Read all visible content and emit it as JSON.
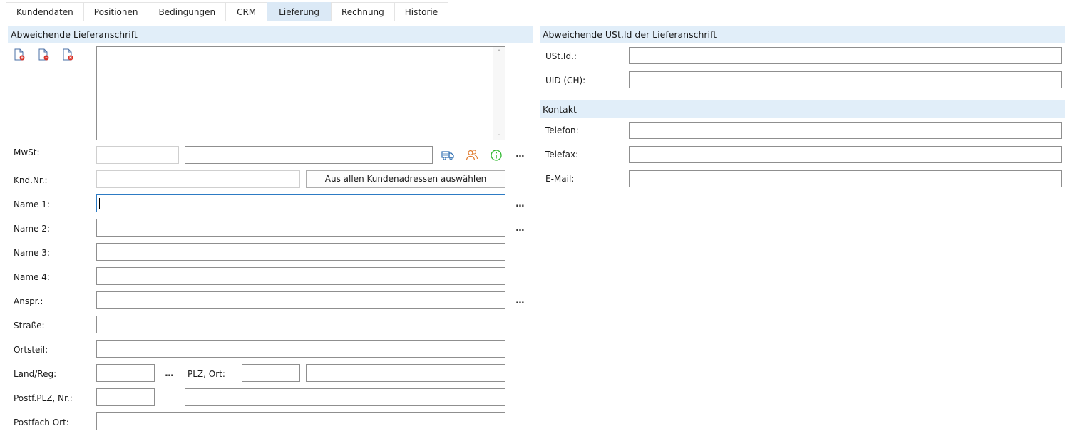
{
  "tabs": [
    {
      "label": "Kundendaten"
    },
    {
      "label": "Positionen"
    },
    {
      "label": "Bedingungen"
    },
    {
      "label": "CRM"
    },
    {
      "label": "Lieferung"
    },
    {
      "label": "Rechnung"
    },
    {
      "label": "Historie"
    }
  ],
  "active_tab": "Lieferung",
  "left": {
    "header": "Abweichende Lieferanschrift",
    "icons": [
      "document-add-icon",
      "document-copy-icon",
      "document-delete-icon"
    ],
    "address_text": "",
    "mwst_label": "MwSt:",
    "mwst_code": "",
    "mwst_text": "",
    "kndnr_label": "Knd.Nr.:",
    "kndnr_value": "",
    "select_button": "Aus allen Kundenadressen auswählen",
    "name1_label": "Name 1:",
    "name1_value": "",
    "name2_label": "Name 2:",
    "name2_value": "",
    "name3_label": "Name 3:",
    "name3_value": "",
    "name4_label": "Name 4:",
    "name4_value": "",
    "anspr_label": "Anspr.:",
    "anspr_value": "",
    "strasse_label": "Straße:",
    "strasse_value": "",
    "ortsteil_label": "Ortsteil:",
    "ortsteil_value": "",
    "land_label": "Land/Reg:",
    "land_value": "",
    "plzort_label": "PLZ, Ort:",
    "plz_value": "",
    "ort_value": "",
    "postfplz_label": "Postf.PLZ, Nr.:",
    "postfplz_value": "",
    "postfnr_value": "",
    "postfort_label": "Postfach Ort:",
    "postfort_value": "",
    "ellipsis": "..."
  },
  "right": {
    "header": "Abweichende USt.Id der Lieferanschrift",
    "ustid_label": "USt.Id.:",
    "ustid_value": "",
    "uid_label": "UID (CH):",
    "uid_value": "",
    "kontakt_header": "Kontakt",
    "telefon_label": "Telefon:",
    "telefon_value": "",
    "telefax_label": "Telefax:",
    "telefax_value": "",
    "email_label": "E-Mail:",
    "email_value": ""
  },
  "colors": {
    "section_bg": "#e1eef9",
    "active_tab_bg": "#dbe9f6",
    "truck_icon": "#2b6cb0",
    "contacts_icon": "#e07a2c",
    "info_icon": "#2fb82f",
    "doc_icon_badge": "#d9342b"
  }
}
